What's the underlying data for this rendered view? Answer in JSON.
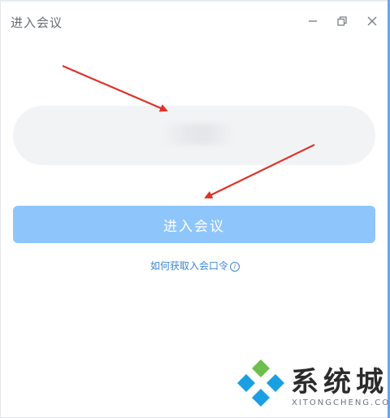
{
  "window": {
    "title": "进入会议",
    "controls": {
      "minimize": "minimize-icon",
      "restore": "restore-icon",
      "close": "close-icon"
    }
  },
  "form": {
    "password_placeholder": "",
    "join_label": "进入会议",
    "help_label": "如何获取入会口令",
    "help_icon": "ⓘ"
  },
  "watermark": {
    "name": "系统城",
    "domain": "XITONGCHENG.COM"
  },
  "colors": {
    "primary_disabled": "#8ec6fb",
    "link": "#3d86d6",
    "input_bg": "#f2f3f5",
    "annotation_arrow": "#e0312a"
  }
}
